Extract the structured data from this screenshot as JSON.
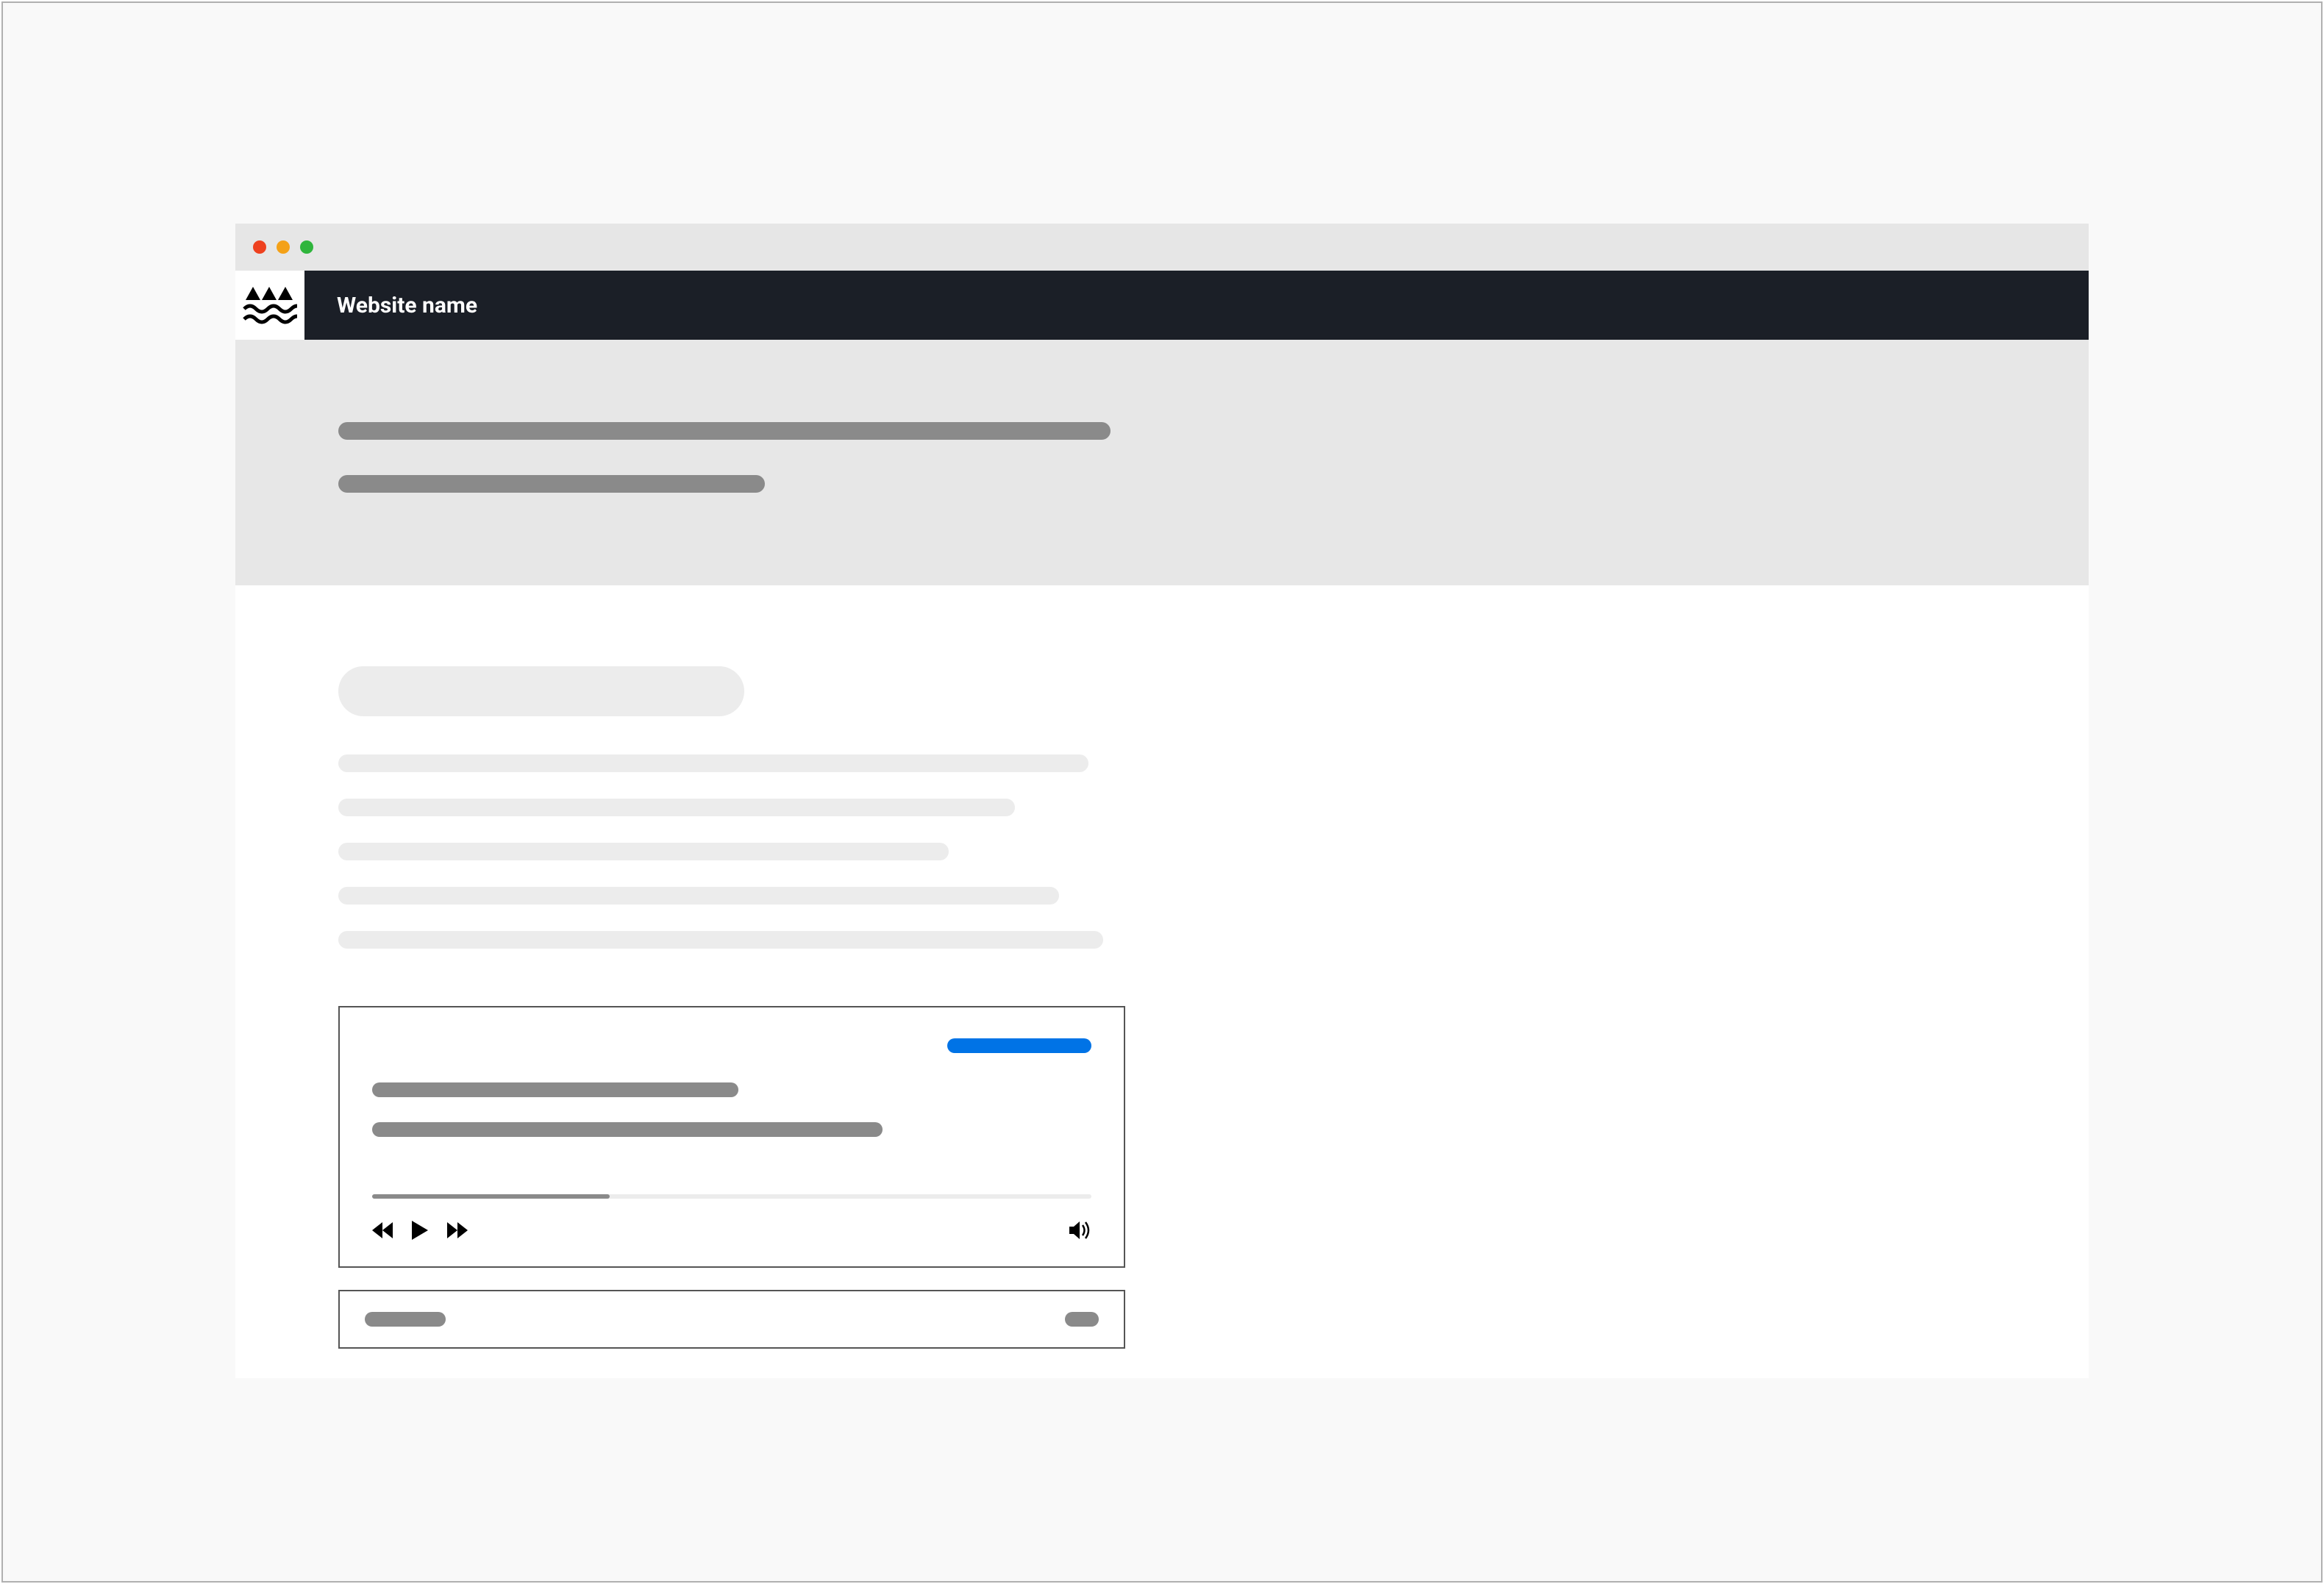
{
  "header": {
    "site_name": "Website name"
  },
  "traffic_lights": {
    "close": "close",
    "minimize": "minimize",
    "maximize": "maximize"
  },
  "audio_player": {
    "progress_percent": 33,
    "controls": {
      "rewind": "rewind",
      "play": "play",
      "forward": "forward",
      "volume": "volume"
    }
  }
}
